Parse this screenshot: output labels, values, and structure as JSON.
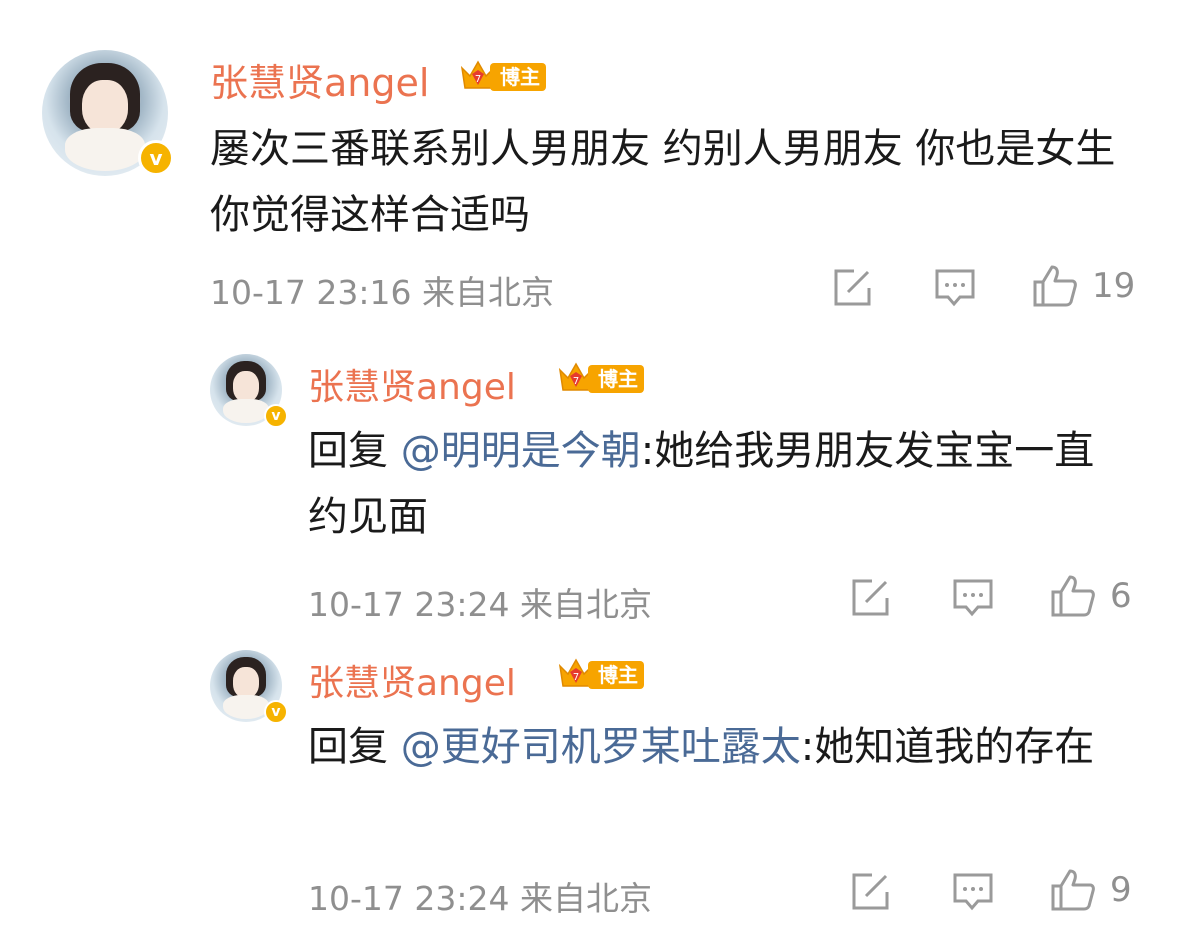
{
  "colors": {
    "username": "#eb7350",
    "mention": "#4a6a96",
    "meta": "#8f8f8f",
    "text": "#1a1a1a",
    "badge": "#f7a400"
  },
  "comments": [
    {
      "username": "张慧贤angel",
      "badge_label": "博主",
      "verified_mark": "v",
      "text": "屡次三番联系别人男朋友 约别人男朋友 你也是女生 你觉得这样合适吗",
      "time": "10-17 23:16",
      "location": "来自北京",
      "likes": "19"
    },
    {
      "username": "张慧贤angel",
      "badge_label": "博主",
      "verified_mark": "v",
      "reply_prefix": "回复",
      "mention": "@明明是今朝",
      "text": ":她给我男朋友发宝宝一直约见面",
      "time": "10-17 23:24",
      "location": "来自北京",
      "likes": "6"
    },
    {
      "username": "张慧贤angel",
      "badge_label": "博主",
      "verified_mark": "v",
      "reply_prefix": "回复",
      "mention": "@更好司机罗某吐露太",
      "text": ":她知道我的存在",
      "time": "10-17 23:24",
      "location": "来自北京",
      "likes": "9"
    }
  ]
}
